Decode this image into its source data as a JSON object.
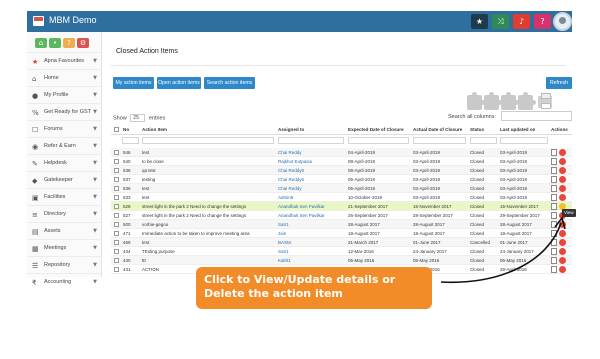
{
  "app": {
    "title": "MBM Demo"
  },
  "topbar_icons": [
    "star-icon",
    "share-icon",
    "bell-icon",
    "help-icon",
    "user-avatar-icon"
  ],
  "colors": {
    "header_bg": "#2f6f9f",
    "button": "#2e88c9",
    "callout": "#f28c28",
    "highlight_row": "#e9f7c4"
  },
  "sidebar": {
    "items": [
      {
        "label": "Apna Favourites",
        "icon": "star-icon"
      },
      {
        "label": "Home",
        "icon": "home-icon"
      },
      {
        "label": "My Profile",
        "icon": "user-icon"
      },
      {
        "label": "Get Ready for GST",
        "icon": "percent-icon"
      },
      {
        "label": "Forums",
        "icon": "chat-icon"
      },
      {
        "label": "Refer & Earn",
        "icon": "eye-icon"
      },
      {
        "label": "Helpdesk",
        "icon": "wrench-icon"
      },
      {
        "label": "Gatekeeper",
        "icon": "shield-icon"
      },
      {
        "label": "Facilities",
        "icon": "building-icon"
      },
      {
        "label": "Directory",
        "icon": "list-icon"
      },
      {
        "label": "Assets",
        "icon": "assets-icon"
      },
      {
        "label": "Meetings",
        "icon": "calendar-icon"
      },
      {
        "label": "Repository",
        "icon": "database-icon"
      },
      {
        "label": "Accounting",
        "icon": "rupee-icon"
      }
    ]
  },
  "main": {
    "title": "Closed Action Items",
    "buttons": {
      "my": "My action items",
      "open": "Open action items",
      "search": "Search action items",
      "refresh": "Refresh"
    },
    "show": {
      "prefix": "Show",
      "value": "25",
      "suffix": "entries"
    },
    "search_label": "Search all columns:",
    "columns": [
      "No",
      "Action Item",
      "Assigned to",
      "Expected Date of Closure",
      "Actual Date of Closure",
      "Status",
      "Last updated on",
      "Actions"
    ],
    "rows": [
      {
        "no": "546",
        "item": "test",
        "assigned": "Chai Reddy",
        "expected": "04-April-2019",
        "actual": "03-April-2019",
        "status": "Closed",
        "updated": "03-April-2019"
      },
      {
        "no": "540",
        "item": "to be close",
        "assigned": "Rajkhot Eutpasia",
        "expected": "08-April-2019",
        "actual": "03-April-2019",
        "status": "Closed",
        "updated": "03-April-2019"
      },
      {
        "no": "538",
        "item": "qa test",
        "assigned": "Chai Reddy6",
        "expected": "08-April-2019",
        "actual": "03-April-2019",
        "status": "Closed",
        "updated": "03-April-2019"
      },
      {
        "no": "537",
        "item": "testing",
        "assigned": "Chai Reddy6",
        "expected": "05-April-2019",
        "actual": "03-April-2019",
        "status": "Closed",
        "updated": "03-April-2019"
      },
      {
        "no": "536",
        "item": "test",
        "assigned": "Chai Reddy",
        "expected": "05-April-2019",
        "actual": "03-April-2019",
        "status": "Closed",
        "updated": "03-April-2019"
      },
      {
        "no": "533",
        "item": "test",
        "assigned": "Admin5",
        "expected": "10-October-2019",
        "actual": "03-April-2019",
        "status": "Closed",
        "updated": "03-April-2019"
      },
      {
        "no": "528",
        "item": "street light in the park 2 Need to change the settings",
        "assigned": "Anandhak Sen Pavilkar",
        "expected": "21-September 2017",
        "actual": "15-November 2017",
        "status": "Closed",
        "updated": "15-November 2017",
        "highlight": true
      },
      {
        "no": "527",
        "item": "street light in the park 2 Need to change the settings",
        "assigned": "Anandhak Sen Pavilkar",
        "expected": "26-September 2017",
        "actual": "28-September 2017",
        "status": "Closed",
        "updated": "29-September 2017"
      },
      {
        "no": "500",
        "item": "vorbie-gegoo",
        "assigned": "Satr1",
        "expected": "28-August 2017",
        "actual": "28-August 2017",
        "status": "Closed",
        "updated": "28-August 2017"
      },
      {
        "no": "471",
        "item": "Immediate action to be taken to improve meeting area",
        "assigned": "Jain",
        "expected": "18-August 2017",
        "actual": "18-August 2017",
        "status": "Closed",
        "updated": "18-August 2017"
      },
      {
        "no": "469",
        "item": "test",
        "assigned": "BASM",
        "expected": "31-March 2017",
        "actual": "01-June 2017",
        "status": "Cancelled",
        "updated": "01-June 2017"
      },
      {
        "no": "434",
        "item": "TEsting purpose",
        "assigned": "Satr1",
        "expected": "12-Mar-2016",
        "actual": "24-January 2017",
        "status": "Closed",
        "updated": "24-January 2017"
      },
      {
        "no": "430",
        "item": "ttt",
        "assigned": "Kalrit1",
        "expected": "05-May 2016",
        "actual": "06-May 2016",
        "status": "Closed",
        "updated": "06-May 2016"
      },
      {
        "no": "431",
        "item": "ACTION",
        "assigned": "Satr1",
        "expected": "28-April 2016",
        "actual": "28-April 2016",
        "status": "Closed",
        "updated": "28-April 2016"
      }
    ]
  },
  "tooltip": "View",
  "callout": {
    "text": "Click to View/Update details or Delete the action item"
  }
}
